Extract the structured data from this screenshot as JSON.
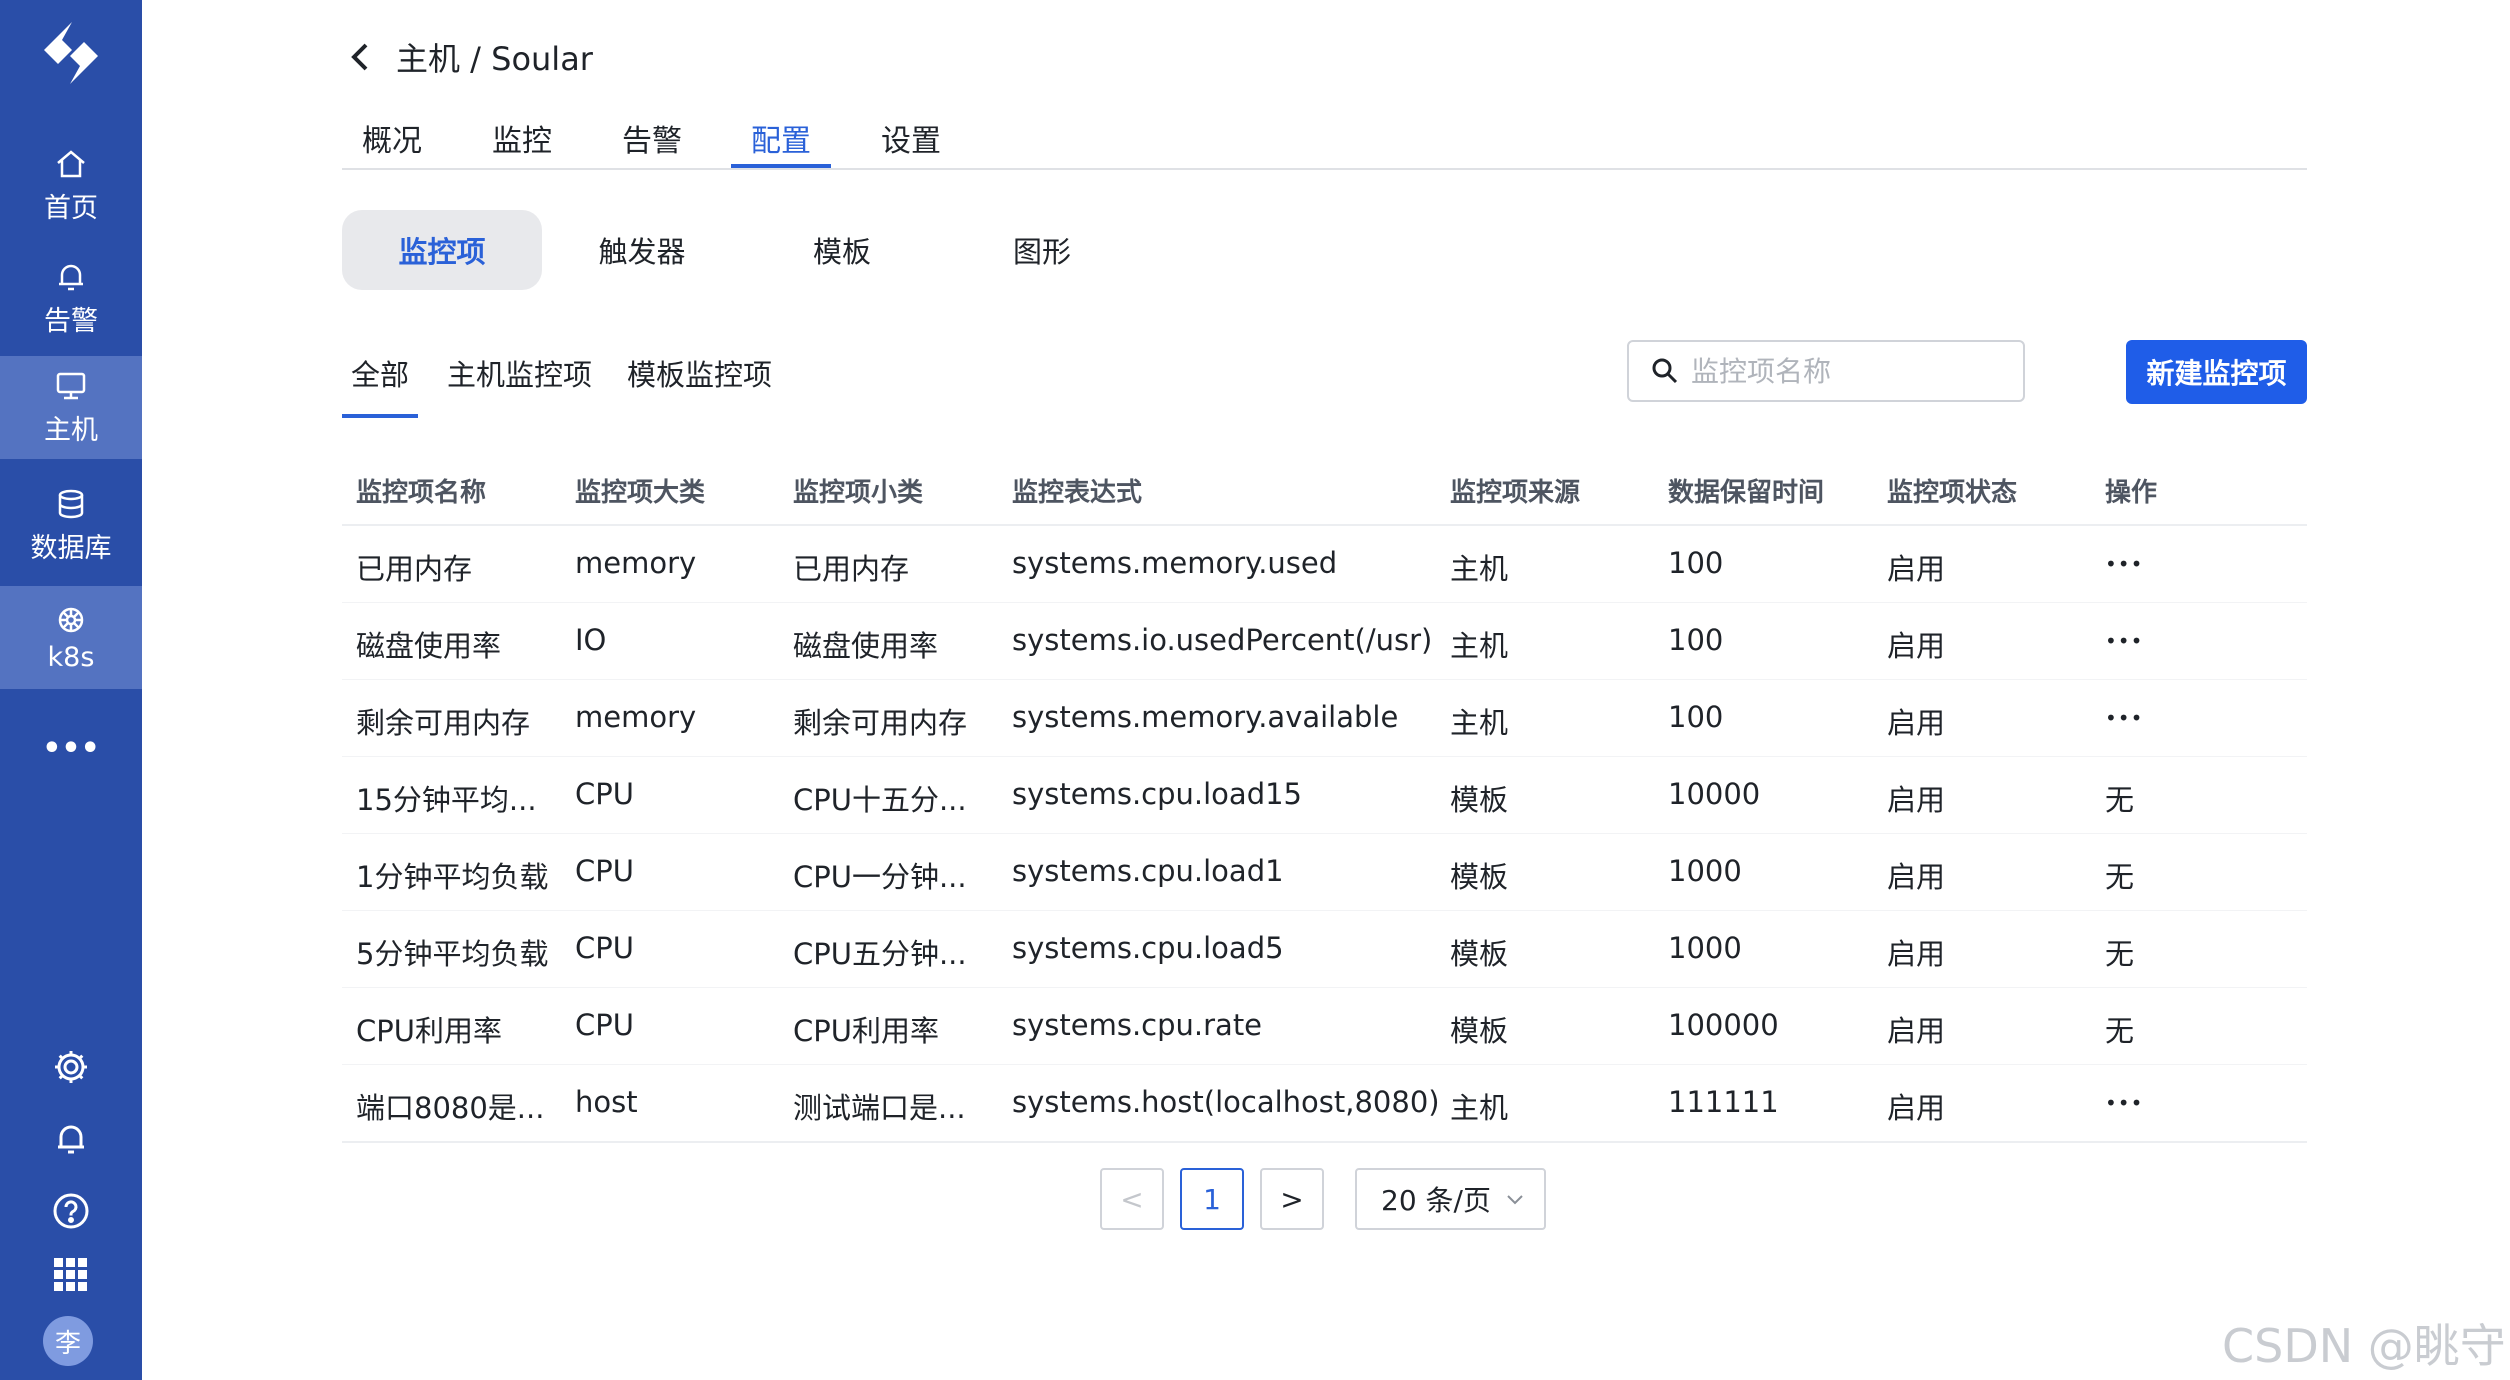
{
  "sidebar": {
    "items": [
      {
        "label": "首页",
        "icon": "home-icon"
      },
      {
        "label": "告警",
        "icon": "bell-icon"
      },
      {
        "label": "主机",
        "icon": "monitor-icon"
      },
      {
        "label": "数据库",
        "icon": "database-icon"
      },
      {
        "label": "k8s",
        "icon": "helm-icon"
      }
    ],
    "more": "•••",
    "avatar_text": "李",
    "colors": {
      "background": "#2a4ea8",
      "active": "#5473c1"
    }
  },
  "header": {
    "breadcrumb": "主机 / Soular",
    "tabs": [
      "概况",
      "监控",
      "告警",
      "配置",
      "设置"
    ],
    "active_tab": "配置"
  },
  "segments": {
    "items": [
      "监控项",
      "触发器",
      "模板",
      "图形"
    ],
    "active": "监控项"
  },
  "filters": {
    "items": [
      "全部",
      "主机监控项",
      "模板监控项"
    ],
    "active": "全部"
  },
  "search": {
    "placeholder": "监控项名称",
    "value": ""
  },
  "create_button": "新建监控项",
  "table": {
    "columns": [
      "监控项名称",
      "监控项大类",
      "监控项小类",
      "监控表达式",
      "监控项来源",
      "数据保留时间",
      "监控项状态",
      "操作"
    ],
    "rows": [
      [
        "已用内存",
        "memory",
        "已用内存",
        "systems.memory.used",
        "主机",
        "100",
        "启用",
        "•••"
      ],
      [
        "磁盘使用率",
        "IO",
        "磁盘使用率",
        "systems.io.usedPercent(/usr)",
        "主机",
        "100",
        "启用",
        "•••"
      ],
      [
        "剩余可用内存",
        "memory",
        "剩余可用内存",
        "systems.memory.available",
        "主机",
        "100",
        "启用",
        "•••"
      ],
      [
        "15分钟平均...",
        "CPU",
        "CPU十五分...",
        "systems.cpu.load15",
        "模板",
        "10000",
        "启用",
        "无"
      ],
      [
        "1分钟平均负载",
        "CPU",
        "CPU一分钟...",
        "systems.cpu.load1",
        "模板",
        "1000",
        "启用",
        "无"
      ],
      [
        "5分钟平均负载",
        "CPU",
        "CPU五分钟...",
        "systems.cpu.load5",
        "模板",
        "1000",
        "启用",
        "无"
      ],
      [
        "CPU利用率",
        "CPU",
        "CPU利用率",
        "systems.cpu.rate",
        "模板",
        "100000",
        "启用",
        "无"
      ],
      [
        "端口8080是...",
        "host",
        "测试端口是...",
        "systems.host(localhost,8080)",
        "主机",
        "111111",
        "启用",
        "•••"
      ]
    ]
  },
  "pagination": {
    "prev": "<",
    "current_page": "1",
    "next": ">",
    "page_size": "20 条/页"
  },
  "watermark": "CSDN @眺守",
  "accent_color": "#2a61d8"
}
